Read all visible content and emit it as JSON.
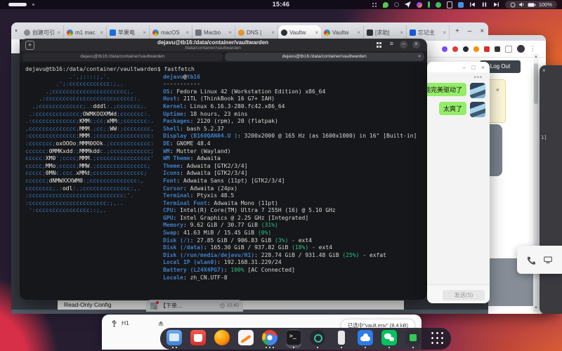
{
  "topbar": {
    "time": "15:46",
    "battery_percent": "100%",
    "tray": [
      {
        "name": "ime-tray-icon",
        "type": "grid"
      },
      {
        "name": "green-leaf-tray-icon",
        "type": "leaf"
      },
      {
        "name": "dim-status-tray-icon",
        "type": "ring"
      },
      {
        "name": "telegram-tray-icon",
        "type": "plane"
      },
      {
        "name": "purple-app-tray-icon",
        "type": "pdot"
      },
      {
        "name": "green-bar-tray-icon",
        "type": "bar"
      },
      {
        "name": "wechat-tray-icon",
        "type": "gdot"
      },
      {
        "name": "clipboard-tray-icon",
        "type": "clip"
      },
      {
        "name": "blue-app-tray-icon",
        "type": "bsq"
      }
    ]
  },
  "browser": {
    "tabs": [
      {
        "label": "创建可引",
        "favicon": "apple"
      },
      {
        "label": "m1 mac",
        "favicon": "google"
      },
      {
        "label": "苹果电",
        "favicon": "calendar"
      },
      {
        "label": "macOS",
        "favicon": "google"
      },
      {
        "label": "Macbo",
        "favicon": "laptop"
      },
      {
        "label": "DNS |",
        "favicon": "orange"
      },
      {
        "label": "Vaultw",
        "favicon": "vaultwarden",
        "active": true
      },
      {
        "label": "Vaultw",
        "favicon": "google"
      },
      {
        "label": "[求助]",
        "favicon": "dark"
      },
      {
        "label": "忘记主",
        "favicon": "bitwarden"
      }
    ],
    "new_tab_label": "+",
    "controls": {
      "minimize": "–",
      "close": "×"
    },
    "page_heading": "Read-Only Config",
    "chat_tab": {
      "title": "【下单...",
      "time": "10:40",
      "avatar_colors": [
        "#8fb6d9",
        "#d9a98f",
        "#a8c8a0",
        "#9aa3ad"
      ]
    }
  },
  "back_window": {
    "logout_label": "Log Out",
    "alert_close": "×",
    "snippet": "1]",
    "close": "×"
  },
  "terminal": {
    "title": "dejavu@tb16:/data/container/vaultwarden",
    "subtitle": "/data/container/vaultwarden",
    "tabs": [
      {
        "label": "dejavu@tb16:/data/container/vaultwarden"
      },
      {
        "label": "dejavu@tb16:/data/container/vaultwarden",
        "active": true,
        "close": "×"
      }
    ],
    "new_tab_label": "+",
    "controls": {
      "minimize": "–",
      "close": "×"
    },
    "prompt": "dejavu@tb16:/data/container/vaultwarden$ fastfetch",
    "fastfetch": {
      "title_user": "dejavu",
      "title_at": "@",
      "title_host": "tb16",
      "separator": "-----------",
      "colors": {
        "blue": "#3f7fc4",
        "fg": "#d6d6d1",
        "green": "#2dc081"
      },
      "ascii": [
        "             .',;::::;,'.",
        "         .';:cccccccccccc:;,.",
        "      .;cccccccccccccccccccccc;.",
        "    .:cccccccccccccccccccccccccc:.",
        "  .;ccccccccccccc;.:dddl:.;ccccccc;.",
        " .:ccccccccccccc;OWMKOOXMWd;ccccccc:.",
        ".:ccccccccccccc;KMMc;cc;xMMc;ccccccc:.",
        ",cccccccccccccc;MMM.;cc;;WW:;cccccccc,",
        ":cccccccccccccc;MMM.;cccccccccccccccc:",
        ":ccccccc;oxOOOo;MMM0OOk.;cccccccccccc:",
        "cccccc:0MMKxdd:;MMMkddc.;cccccccccccc;",
        "ccccc:XM0';cccc;MMM.;cccccccccccccccc'",
        "ccccc;MMo;ccccc;MMW.;ccccccccccccccc;",
        "ccccc;0MNc.ccc.xMMd;ccccccccccccccc;",
        "cccccc;dNMWXXXWM0:;cccccccccccccc:,",
        "cccccccc;.:odl:.;cccccccccccccc:,.",
        ":cccccccccccccccccccccccccccc:'.",
        ":ccccccccccccccccccccccc:;,..",
        " ':cccccccccccccccc::;,."
      ],
      "lines": [
        {
          "key": "OS",
          "parts": [
            [
              "Fedora Linux 42 (Workstation Edition) x86_64",
              "fg"
            ]
          ]
        },
        {
          "key": "Host",
          "parts": [
            [
              "21TL (ThinkBook 16 G7+ IAH)",
              "fg"
            ]
          ]
        },
        {
          "key": "Kernel",
          "parts": [
            [
              "Linux 6.16.3-280.fc42.x86_64",
              "fg"
            ]
          ]
        },
        {
          "key": "Uptime",
          "parts": [
            [
              "18 hours, 23 mins",
              "fg"
            ]
          ]
        },
        {
          "key": "Packages",
          "parts": [
            [
              "2120 (rpm), 20 (flatpak)",
              "fg"
            ]
          ]
        },
        {
          "key": "Shell",
          "parts": [
            [
              "bash 5.2.37",
              "fg"
            ]
          ]
        },
        {
          "key": "Display (B160QAN04.U )",
          "parts": [
            [
              "3200x2000 @ 165 Hz (as 1600x1000) in 16\" [Built-in]",
              "fg"
            ]
          ]
        },
        {
          "key": "DE",
          "parts": [
            [
              "GNOME 48.4",
              "fg"
            ]
          ]
        },
        {
          "key": "WM",
          "parts": [
            [
              "Mutter (Wayland)",
              "fg"
            ]
          ]
        },
        {
          "key": "WM Theme",
          "parts": [
            [
              "Adwaita",
              "fg"
            ]
          ]
        },
        {
          "key": "Theme",
          "parts": [
            [
              "Adwaita [GTK2/3/4]",
              "fg"
            ]
          ]
        },
        {
          "key": "Icons",
          "parts": [
            [
              "Adwaita [GTK2/3/4]",
              "fg"
            ]
          ]
        },
        {
          "key": "Font",
          "parts": [
            [
              "Adwaita Sans (11pt) [GTK2/3/4]",
              "fg"
            ]
          ]
        },
        {
          "key": "Cursor",
          "parts": [
            [
              "Adwaita (24px)",
              "fg"
            ]
          ]
        },
        {
          "key": "Terminal",
          "parts": [
            [
              "Ptyxis 48.5",
              "fg"
            ]
          ]
        },
        {
          "key": "Terminal Font",
          "parts": [
            [
              "Adwaita Mono (11pt)",
              "fg"
            ]
          ]
        },
        {
          "key": "CPU",
          "parts": [
            [
              "Intel(R) Core(TM) Ultra 7 255H (16) @ 5.10 GHz",
              "fg"
            ]
          ]
        },
        {
          "key": "GPU",
          "parts": [
            [
              "Intel Graphics @ 2.25 GHz [Integrated]",
              "fg"
            ]
          ]
        },
        {
          "key": "Memory",
          "parts": [
            [
              "9.62 GiB / 30.77 GiB ",
              "fg"
            ],
            [
              "(31%)",
              "green"
            ]
          ]
        },
        {
          "key": "Swap",
          "parts": [
            [
              "41.63 MiB / 15.45 GiB ",
              "fg"
            ],
            [
              "(0%)",
              "green"
            ]
          ]
        },
        {
          "key": "Disk (/)",
          "parts": [
            [
              "27.85 GiB / 906.83 GiB ",
              "fg"
            ],
            [
              "(3%)",
              "green"
            ],
            [
              " - ext4",
              "fg"
            ]
          ]
        },
        {
          "key": "Disk (/data)",
          "parts": [
            [
              "165.30 GiB / 937.82 GiB ",
              "fg"
            ],
            [
              "(18%)",
              "green"
            ],
            [
              " - ext4",
              "fg"
            ]
          ]
        },
        {
          "key": "Disk (/run/media/dejavu/H1)",
          "parts": [
            [
              "228.74 GiB / 931.48 GiB ",
              "fg"
            ],
            [
              "(25%)",
              "green"
            ],
            [
              " - exfat",
              "fg"
            ]
          ]
        },
        {
          "key": "Local IP (wlan0)",
          "parts": [
            [
              "192.168.31.229/24",
              "fg"
            ]
          ]
        },
        {
          "key": "Battery (L24X4PG7)",
          "parts": [
            [
              "100%",
              "green"
            ],
            [
              " [AC Connected]",
              "fg"
            ]
          ]
        },
        {
          "key": "Locale",
          "parts": [
            [
              "zh_CN.UTF-8",
              "fg"
            ]
          ]
        }
      ]
    }
  },
  "wechat": {
    "controls": {
      "minimize": "–",
      "maximize": "□",
      "close": "×"
    },
    "menu": "•••",
    "messages": [
      {
        "text": "能完美驱动了"
      },
      {
        "text": "太爽了"
      }
    ],
    "send_label": "发送(S)"
  },
  "files": {
    "drive": "H1",
    "status": "已选中\"vault.env\" (8.4 kB)"
  },
  "dock": {
    "items": [
      {
        "name": "dock-files",
        "type": "files",
        "dots": 2
      },
      {
        "name": "dock-software",
        "type": "software",
        "dots": 0
      },
      {
        "name": "dock-firefox",
        "type": "firefox",
        "dots": 0
      },
      {
        "name": "dock-text-editor",
        "type": "editor",
        "dots": 0
      },
      {
        "name": "dock-chrome",
        "type": "chrome",
        "dots": 3
      },
      {
        "name": "dock-terminal",
        "type": "terminal",
        "dots": 1,
        "focused": true
      },
      {
        "name": "dock-dark-app",
        "type": "darkapp",
        "dots": 1
      },
      {
        "name": "dock-notes-app",
        "type": "whiterect",
        "dots": 1
      },
      {
        "name": "dock-cloud-app",
        "type": "cloud",
        "dots": 1
      },
      {
        "name": "dock-wechat",
        "type": "wechat",
        "dots": 1
      },
      {
        "name": "dock-proxy-app",
        "type": "clash",
        "dots": 1
      },
      {
        "name": "dock-app-grid",
        "type": "grid",
        "dots": 0
      }
    ]
  }
}
